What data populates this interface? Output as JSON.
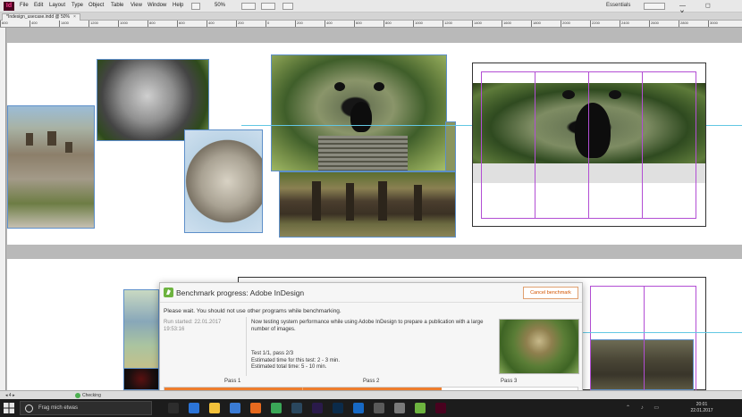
{
  "app": {
    "logo": "Id",
    "menus": [
      "File",
      "Edit",
      "Layout",
      "Type",
      "Object",
      "Table",
      "View",
      "Window",
      "Help"
    ],
    "zoom": "50%",
    "workspace": "Essentials",
    "window_controls": "— ◻ ✕"
  },
  "document": {
    "tab_title": "*Indesign_usecase.indd @ 50%",
    "tab_close": "×"
  },
  "ruler": {
    "ticks": [
      "600",
      "400",
      "1400",
      "1200",
      "1000",
      "800",
      "600",
      "400",
      "200",
      "0",
      "200",
      "400",
      "600",
      "800",
      "1000",
      "1200",
      "1400",
      "1600",
      "1800",
      "2000",
      "2200",
      "2400",
      "2600",
      "2800",
      "3000"
    ]
  },
  "statusbar": {
    "page": "◂ 4 ▸",
    "preflight": "Checking"
  },
  "taskbar": {
    "search_placeholder": "Frag mich etwas",
    "time": "20:01",
    "date": "22.01.2017",
    "icons": [
      {
        "name": "task-view-icon",
        "color": "#2d2d2d"
      },
      {
        "name": "edge-icon",
        "color": "#2b74d8"
      },
      {
        "name": "explorer-icon",
        "color": "#f3c13a"
      },
      {
        "name": "store-icon",
        "color": "#3a7bd5"
      },
      {
        "name": "firefox-icon",
        "color": "#e76a1f"
      },
      {
        "name": "chrome-icon",
        "color": "#3aa757"
      },
      {
        "name": "steam-icon",
        "color": "#2a475e"
      },
      {
        "name": "premiere-icon",
        "color": "#2a1a4a"
      },
      {
        "name": "photoshop-icon",
        "color": "#0b2b4a"
      },
      {
        "name": "outlook-icon",
        "color": "#1769c4"
      },
      {
        "name": "app-icon",
        "color": "#5a5a5a"
      },
      {
        "name": "app2-icon",
        "color": "#7a7a7a"
      },
      {
        "name": "benchmark-icon",
        "color": "#6db33f"
      },
      {
        "name": "indesign-icon",
        "color": "#49021f"
      }
    ],
    "tray": "⌃ ♪ ▭"
  },
  "dialog": {
    "title": "Benchmark progress: Adobe InDesign",
    "cancel_label": "Cancel benchmark",
    "warning": "Please wait. You should not use other programs while benchmarking.",
    "run_started_label": "Run started: 22.01.2017",
    "run_started_time": "19:53:16",
    "message": "Now testing system performance while using Adobe InDesign to prepare a publication with a large number of images.",
    "test_line": "Test 1/1, pass 2/3",
    "time_this_test": "Estimated time for this test: 2 - 3 min.",
    "time_total": "Estimated total time: 5 - 10 min.",
    "passes": [
      "Pass 1",
      "Pass 2",
      "Pass 3"
    ],
    "progress": 0.67,
    "accent": "#ee7d2d"
  }
}
